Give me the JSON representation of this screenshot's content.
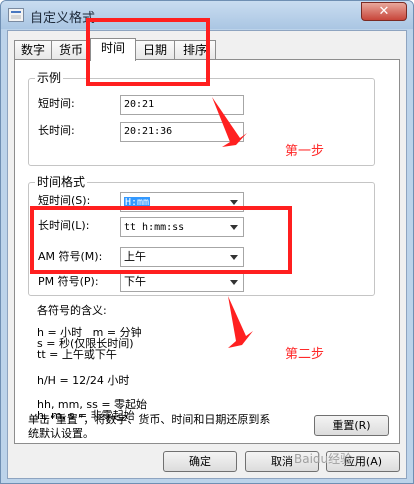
{
  "window": {
    "title": "自定义格式",
    "close_label": "✕"
  },
  "tabs": [
    {
      "label": "数字"
    },
    {
      "label": "货币"
    },
    {
      "label": "时间"
    },
    {
      "label": "日期"
    },
    {
      "label": "排序"
    }
  ],
  "sample": {
    "group_title": "示例",
    "short_label": "短时间:",
    "short_value": "20:21",
    "long_label": "长时间:",
    "long_value": "20:21:36"
  },
  "format": {
    "group_title": "时间格式",
    "short_label": "短时间(S):",
    "short_value": "H:mm",
    "long_label": "长时间(L):",
    "long_value": "tt h:mm:ss",
    "am_label": "AM 符号(M):",
    "am_value": "上午",
    "pm_label": "PM 符号(P):",
    "pm_value": "下午"
  },
  "legend": {
    "heading": "各符号的含义:",
    "line1": "h = 小时   m = 分钟",
    "line2": "s = 秒(仅限长时间)",
    "line3": "tt = 上午或下午",
    "line4": "h/H = 12/24 小时",
    "line5": "hh, mm, ss = 零起始",
    "line6": "h, m, s = 非零起始"
  },
  "reset": {
    "description_line1": "单击“重置”，将数字、货币、时间和日期还原到系",
    "description_line2": "统默认设置。",
    "button_label": "重置(R)"
  },
  "footer": {
    "ok": "确定",
    "cancel": "取消",
    "apply": "应用(A)"
  },
  "annotations": {
    "step1": "第一步",
    "step2": "第二步",
    "highlight_color": "#ff1f1f"
  },
  "watermark": "Baidu经验"
}
